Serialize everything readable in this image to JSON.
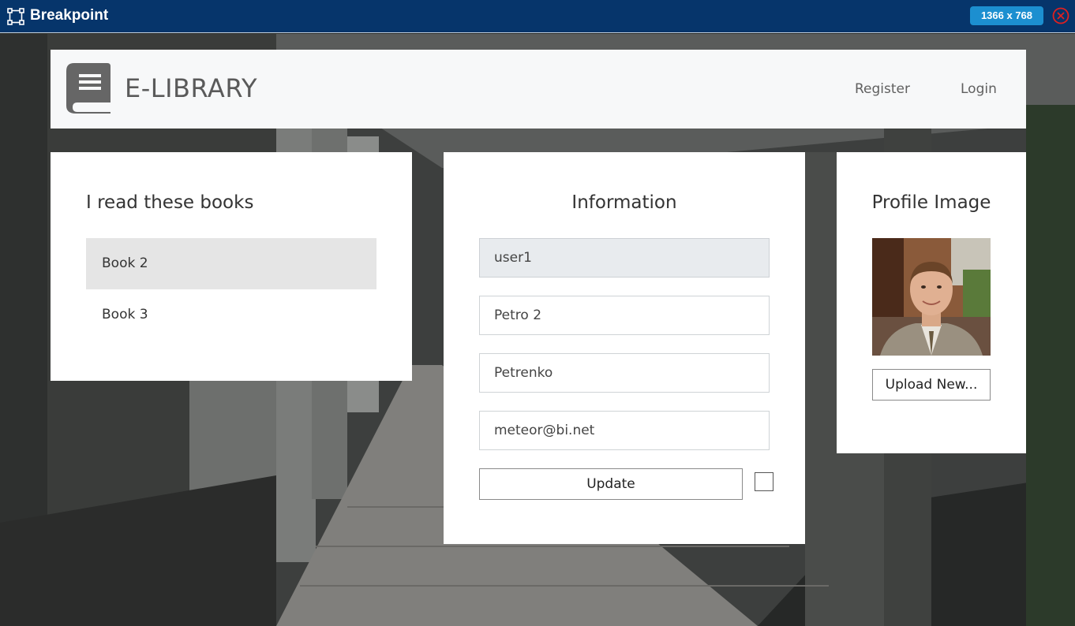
{
  "toolbar": {
    "app_name": "Breakpoint",
    "viewport_size": "1366 x 768"
  },
  "header": {
    "brand": "E-LIBRARY",
    "nav": {
      "register": "Register",
      "login": "Login"
    }
  },
  "books_panel": {
    "title": "I read these books",
    "items": [
      {
        "label": "Book 2",
        "selected": true
      },
      {
        "label": "Book 3",
        "selected": false
      }
    ]
  },
  "info_panel": {
    "title": "Information",
    "fields": {
      "username": "user1",
      "first_name": "Petro 2",
      "last_name": "Petrenko",
      "email": "meteor@bi.net"
    },
    "update_label": "Update",
    "checkbox_checked": false
  },
  "profile_panel": {
    "title": "Profile Image",
    "upload_label": "Upload New..."
  },
  "colors": {
    "toolbar_bg": "#06356b",
    "size_badge": "#1c8fd0",
    "close_icon": "#e02020",
    "header_bg": "#f7f8f9",
    "selected_item_bg": "#e5e5e5",
    "readonly_field_bg": "#e8ebee"
  },
  "icons": {
    "toolbar_logo": "breakpoint-nodes-icon",
    "close": "close-circle-icon",
    "brand": "book-icon"
  }
}
